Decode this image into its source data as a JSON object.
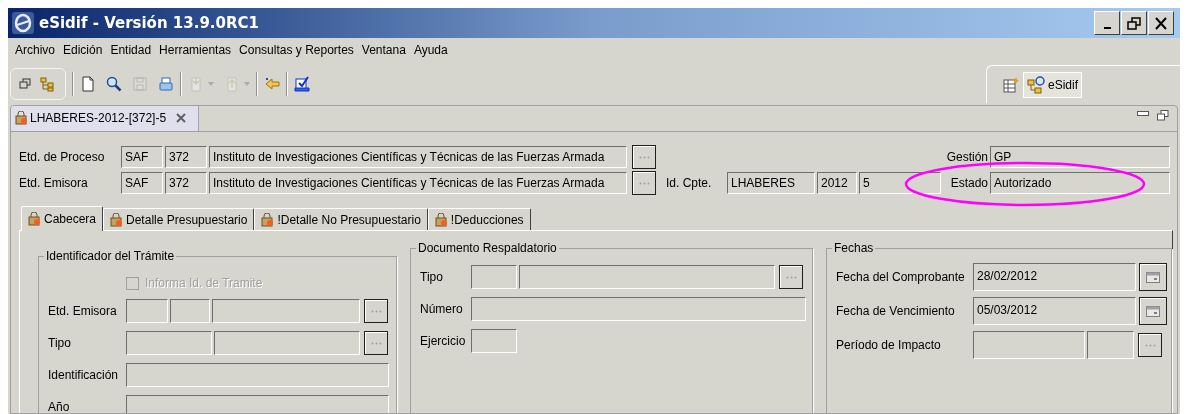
{
  "window": {
    "title": "eSidif - Versión 13.9.0RC1"
  },
  "menu": [
    "Archivo",
    "Edición",
    "Entidad",
    "Herramientas",
    "Consultas y Reportes",
    "Ventana",
    "Ayuda"
  ],
  "toolbar": [
    {
      "kind": "restore",
      "disabled": false
    },
    {
      "kind": "tree",
      "disabled": false
    },
    {
      "kind": "new",
      "disabled": false
    },
    {
      "kind": "search",
      "disabled": false
    },
    {
      "kind": "save",
      "disabled": true
    },
    {
      "kind": "print",
      "disabled": false
    },
    {
      "kind": "import",
      "disabled": true
    },
    {
      "kind": "export",
      "disabled": true
    },
    {
      "kind": "back",
      "disabled": false
    },
    {
      "kind": "check",
      "disabled": false
    }
  ],
  "perspective": {
    "label": "eSidif",
    "selected": true
  },
  "editor_tab": {
    "label": "LHABERES-2012-[372]-5"
  },
  "header": {
    "etd_proceso": {
      "label": "Etd. de Proceso",
      "values": [
        "SAF",
        "372",
        "Instituto de Investigaciones Científicas y Técnicas de las Fuerzas Armada"
      ]
    },
    "gestion": {
      "label": "Gestión",
      "value": "GP"
    },
    "etd_emisora": {
      "label": "Etd. Emisora",
      "values": [
        "SAF",
        "372",
        "Instituto de Investigaciones Científicas y Técnicas de las Fuerzas Armada"
      ]
    },
    "id_cpte": {
      "label": "Id. Cpte.",
      "values": [
        "LHABERES",
        "2012",
        "5"
      ]
    },
    "estado": {
      "label": "Estado",
      "value": "Autorizado"
    }
  },
  "highlight": {
    "kind": "ellipse"
  },
  "tabs": [
    {
      "label": "Cabecera",
      "selected": true
    },
    {
      "label": "Detalle Presupuestario",
      "selected": false
    },
    {
      "label": "!Detalle No Presupuestario",
      "selected": false
    },
    {
      "label": "!Deducciones",
      "selected": false
    }
  ],
  "groups": [
    {
      "title": "Identificador del Trámite",
      "checkbox": {
        "label": "Informa Id. de Tramite",
        "checked": false,
        "disabled": true
      },
      "rows": [
        {
          "label": "Etd. Emisora",
          "kind": "browse"
        },
        {
          "label": "Tipo",
          "kind": "browse"
        },
        {
          "label": "Identificación"
        },
        {
          "label": "Año"
        }
      ]
    },
    {
      "title": "Documento Respaldatorio",
      "rows": [
        {
          "label": "Tipo",
          "kind": "browse"
        },
        {
          "label": "Número"
        },
        {
          "label": "Ejercicio"
        }
      ]
    },
    {
      "title": "Fechas",
      "rows": [
        {
          "label": "Fecha del Comprobante",
          "values": [
            "28/02/2012"
          ],
          "kind": "calendar"
        },
        {
          "label": "Fecha de Vencimiento",
          "values": [
            "05/03/2012"
          ],
          "kind": "calendar"
        },
        {
          "label": "Período de Impacto",
          "kind": "browse"
        }
      ]
    }
  ]
}
